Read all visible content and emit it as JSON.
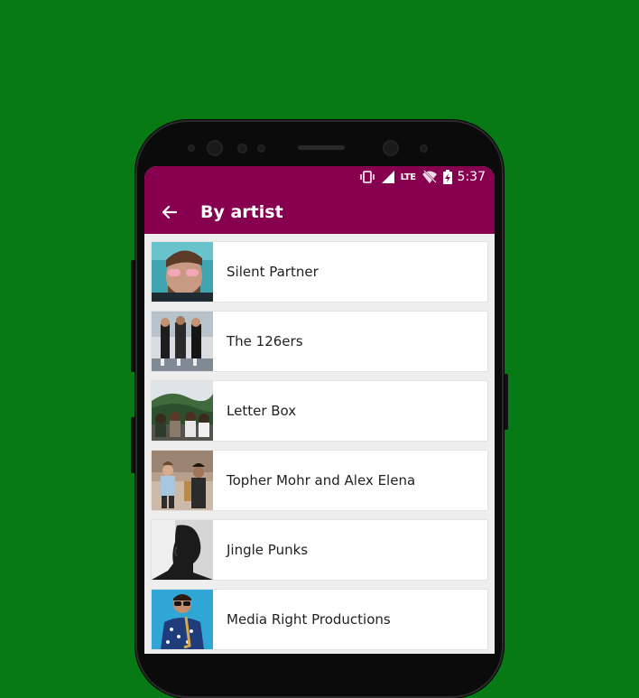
{
  "statusbar": {
    "time": "5:37",
    "network": "LTE",
    "icons": [
      "vibrate-icon",
      "signal-icon",
      "lte-icon",
      "wifi-off-icon",
      "battery-charging-icon"
    ]
  },
  "appbar": {
    "title": "By artist",
    "back_icon": "arrow-left-icon",
    "color": "#87004f"
  },
  "background_color": "#087a15",
  "artists": [
    {
      "name": "Silent Partner"
    },
    {
      "name": "The 126ers"
    },
    {
      "name": "Letter Box"
    },
    {
      "name": "Topher Mohr and Alex Elena"
    },
    {
      "name": "Jingle Punks"
    },
    {
      "name": "Media Right Productions"
    }
  ]
}
